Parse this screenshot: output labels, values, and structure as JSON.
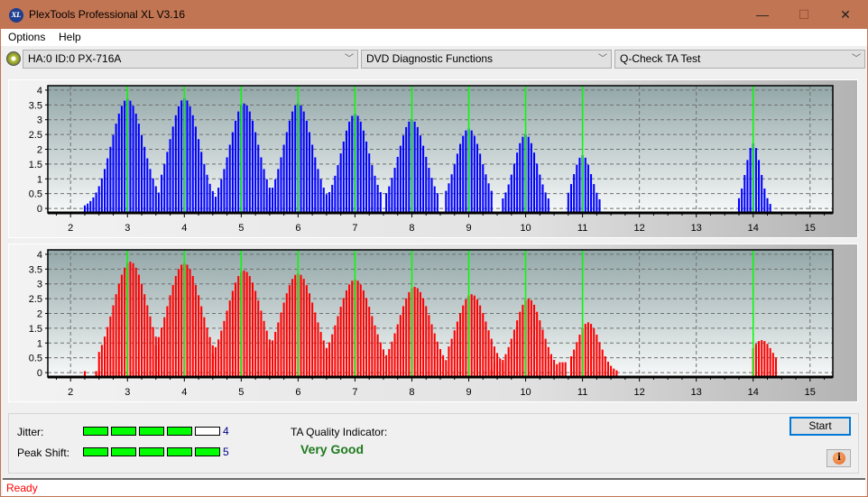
{
  "window": {
    "title": "PlexTools Professional XL V3.16",
    "app_icon": "XL",
    "controls": {
      "minimize": "—",
      "maximize": "☐",
      "close": "✕"
    }
  },
  "menu": [
    "Options",
    "Help"
  ],
  "toolbar": {
    "drive": "HA:0 ID:0  PX-716A",
    "function": "DVD Diagnostic Functions",
    "test": "Q-Check TA Test",
    "chevron": "﹀"
  },
  "colors": {
    "titlebar": "#c27552",
    "top_bars": "#0000ff",
    "bottom_bars": "#ff0000",
    "marker": "#00ff00",
    "meter_on": "#00ff00",
    "quality": "#1e7a1e",
    "status": "#ff0000"
  },
  "chart_data": [
    {
      "type": "bar",
      "name": "land-pit-distribution",
      "xlabel": "",
      "ylabel": "",
      "xlim": [
        1.6,
        15.4
      ],
      "ylim": [
        -0.15,
        4.15
      ],
      "xticks": [
        2,
        3,
        4,
        5,
        6,
        7,
        8,
        9,
        10,
        11,
        12,
        13,
        14,
        15
      ],
      "yticks": [
        0,
        0.5,
        1,
        1.5,
        2,
        2.5,
        3,
        3.5,
        4
      ],
      "ytick_labels": [
        "0",
        "0.5",
        "1",
        "1.5",
        "2",
        "2.5",
        "3",
        "3.5",
        "4"
      ],
      "markers": [
        3,
        4,
        5,
        6,
        7,
        8,
        9,
        10,
        11,
        14
      ],
      "grid": true,
      "peaks": [
        {
          "center": 3.0,
          "height": 3.7,
          "width": 0.28,
          "from": 2.25,
          "to": 3.55
        },
        {
          "center": 4.0,
          "height": 3.72,
          "width": 0.26,
          "from": 3.6,
          "to": 4.55
        },
        {
          "center": 5.05,
          "height": 3.55,
          "width": 0.25,
          "from": 4.6,
          "to": 5.55
        },
        {
          "center": 6.0,
          "height": 3.55,
          "width": 0.25,
          "from": 5.5,
          "to": 6.55
        },
        {
          "center": 7.0,
          "height": 3.2,
          "width": 0.24,
          "from": 6.55,
          "to": 7.45
        },
        {
          "center": 8.0,
          "height": 3.0,
          "width": 0.24,
          "from": 7.55,
          "to": 8.45
        },
        {
          "center": 9.0,
          "height": 2.7,
          "width": 0.23,
          "from": 8.6,
          "to": 9.4
        },
        {
          "center": 10.0,
          "height": 2.5,
          "width": 0.2,
          "from": 9.6,
          "to": 10.4
        },
        {
          "center": 11.0,
          "height": 1.8,
          "width": 0.16,
          "from": 10.75,
          "to": 11.3
        },
        {
          "center": 14.0,
          "height": 2.2,
          "width": 0.13,
          "from": 13.75,
          "to": 14.3
        }
      ]
    },
    {
      "type": "bar",
      "name": "pit-land-distribution",
      "xlabel": "",
      "ylabel": "",
      "xlim": [
        1.6,
        15.4
      ],
      "ylim": [
        -0.15,
        4.15
      ],
      "xticks": [
        2,
        3,
        4,
        5,
        6,
        7,
        8,
        9,
        10,
        11,
        12,
        13,
        14,
        15
      ],
      "yticks": [
        0,
        0.5,
        1,
        1.5,
        2,
        2.5,
        3,
        3.5,
        4
      ],
      "ytick_labels": [
        "0",
        "0.5",
        "1",
        "1.5",
        "2",
        "2.5",
        "3",
        "3.5",
        "4"
      ],
      "markers": [
        3,
        4,
        5,
        6,
        7,
        8,
        9,
        10,
        11,
        14
      ],
      "grid": true,
      "peaks": [
        {
          "center": 3.05,
          "height": 3.75,
          "width": 0.3,
          "from": 2.5,
          "to": 3.55
        },
        {
          "center": 4.0,
          "height": 3.7,
          "width": 0.3,
          "from": 3.5,
          "to": 4.55
        },
        {
          "center": 5.05,
          "height": 3.45,
          "width": 0.3,
          "from": 4.5,
          "to": 5.55
        },
        {
          "center": 6.0,
          "height": 3.35,
          "width": 0.3,
          "from": 5.5,
          "to": 6.55
        },
        {
          "center": 7.0,
          "height": 3.15,
          "width": 0.3,
          "from": 6.5,
          "to": 7.5
        },
        {
          "center": 8.05,
          "height": 2.9,
          "width": 0.28,
          "from": 7.55,
          "to": 8.6
        },
        {
          "center": 9.05,
          "height": 2.65,
          "width": 0.27,
          "from": 8.65,
          "to": 9.6
        },
        {
          "center": 10.05,
          "height": 2.5,
          "width": 0.24,
          "from": 9.6,
          "to": 10.55
        },
        {
          "center": 11.1,
          "height": 1.7,
          "width": 0.2,
          "from": 10.8,
          "to": 11.6
        },
        {
          "center": 14.15,
          "height": 1.1,
          "width": 0.2,
          "from": 14.0,
          "to": 14.4
        }
      ],
      "extra_bars": [
        [
          2.25,
          0.05
        ],
        [
          2.45,
          0.05
        ],
        [
          2.5,
          0.05
        ],
        [
          9.4,
          0.1
        ],
        [
          9.45,
          0.35
        ],
        [
          9.5,
          0.35
        ],
        [
          10.6,
          0.35
        ],
        [
          10.65,
          0.35
        ],
        [
          10.7,
          0.35
        ]
      ]
    }
  ],
  "results": {
    "jitter_label": "Jitter:",
    "jitter_value": "4",
    "jitter_level": 4,
    "peak_shift_label": "Peak Shift:",
    "peak_shift_value": "5",
    "peak_shift_level": 5,
    "meter_max": 5,
    "ta_label": "TA Quality Indicator:",
    "ta_value": "Very Good"
  },
  "buttons": {
    "start": "Start",
    "info": "i"
  },
  "status": "Ready"
}
